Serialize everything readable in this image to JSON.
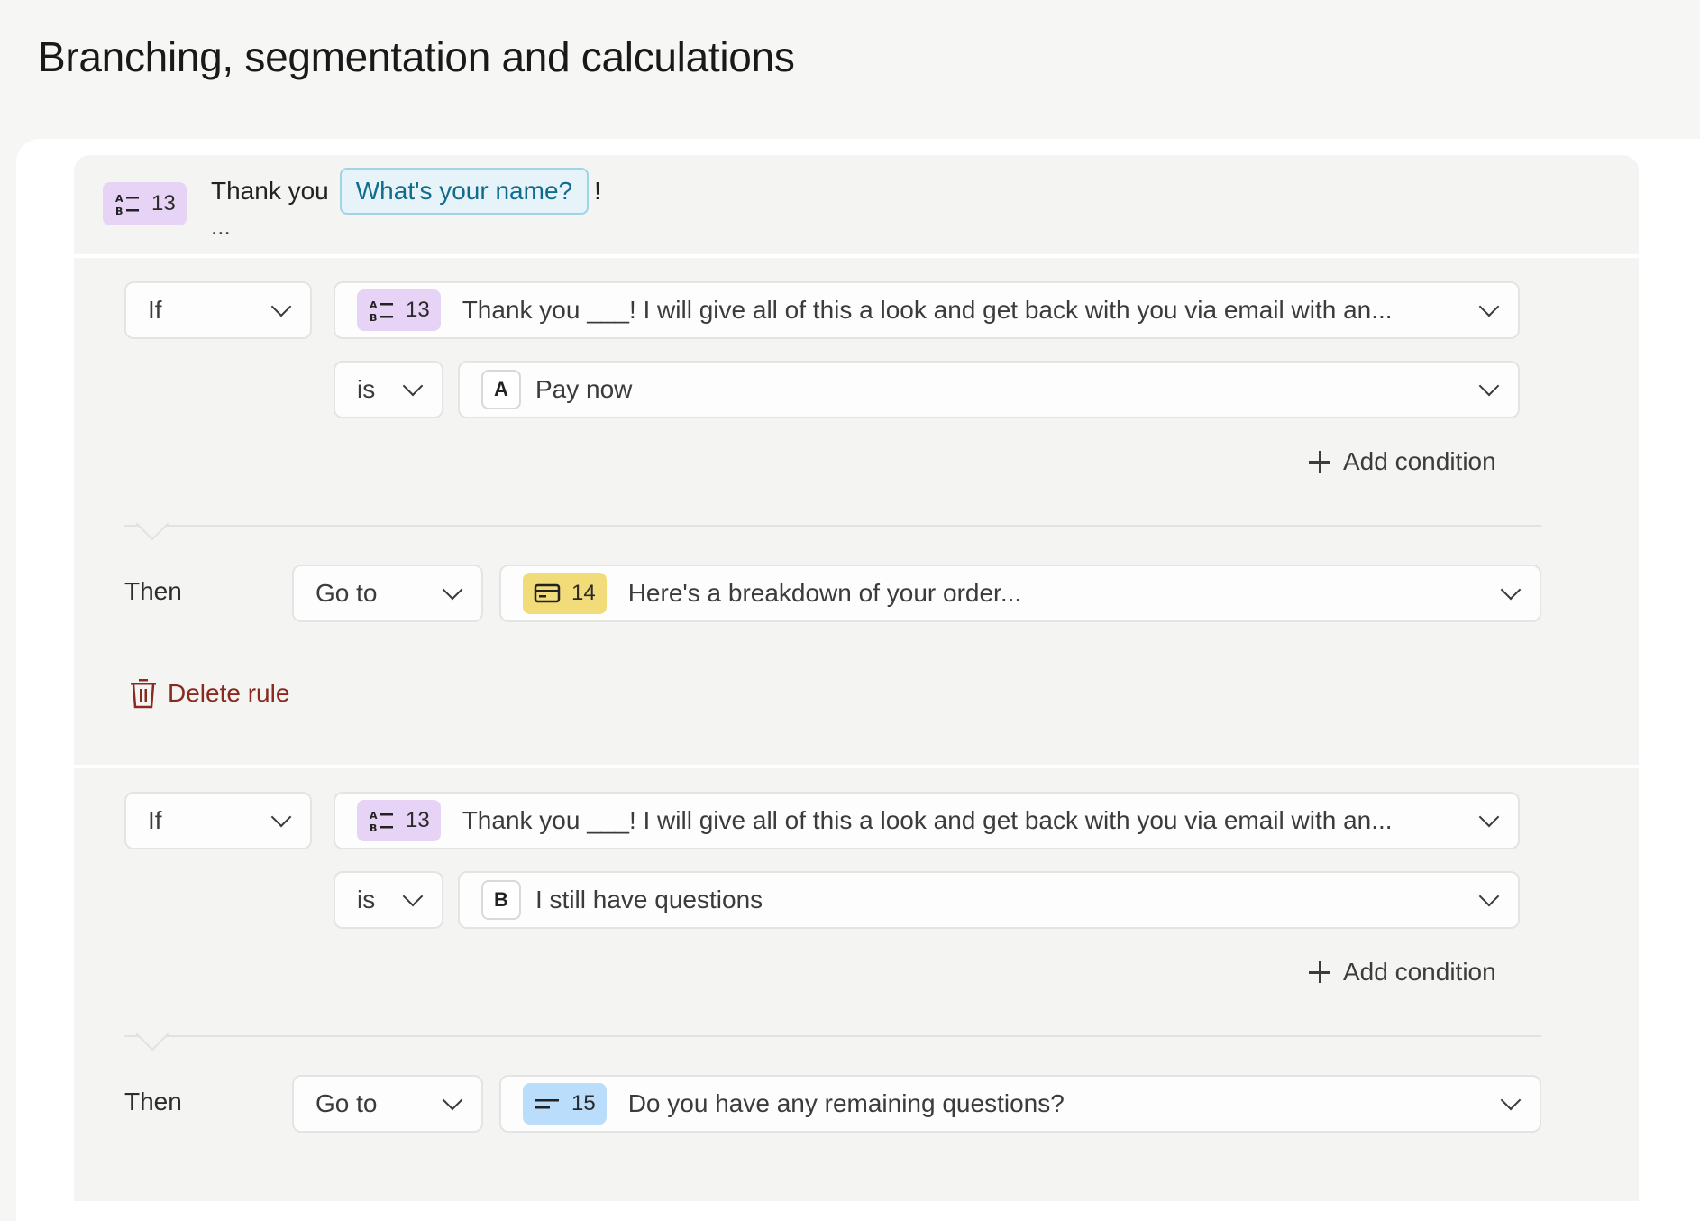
{
  "page": {
    "title": "Branching, segmentation and calculations"
  },
  "header": {
    "question_number": "13",
    "text_before": "Thank you",
    "recall_chip": "What's your name?",
    "text_after": "!",
    "ellipsis": "..."
  },
  "rules": [
    {
      "if_label": "If",
      "question_number": "13",
      "question_text": "Thank you ___! I will give all of this a look and get back with you via email with an...",
      "operator": "is",
      "choice_key": "A",
      "choice_value": "Pay now",
      "add_condition": "Add condition",
      "then_label": "Then",
      "action": "Go to",
      "target_number": "14",
      "target_text": "Here's a breakdown of your order...",
      "delete_label": "Delete rule"
    },
    {
      "if_label": "If",
      "question_number": "13",
      "question_text": "Thank you ___! I will give all of this a look and get back with you via email with an...",
      "operator": "is",
      "choice_key": "B",
      "choice_value": "I still have questions",
      "add_condition": "Add condition",
      "then_label": "Then",
      "action": "Go to",
      "target_number": "15",
      "target_text": "Do you have any remaining questions?"
    }
  ],
  "colors": {
    "multiple_choice_badge": "#e7d3f5",
    "payment_badge": "#f1dc79",
    "short_text_badge": "#b9ddfa",
    "delete": "#8a2a1f",
    "recall_chip_text": "#126b8d"
  },
  "icons": {
    "multiple_choice": "multiple-choice-icon",
    "payment": "payment-card-icon",
    "short_text": "short-text-icon",
    "delete": "trash-icon",
    "add": "plus-icon",
    "dropdown": "chevron-down-icon"
  }
}
